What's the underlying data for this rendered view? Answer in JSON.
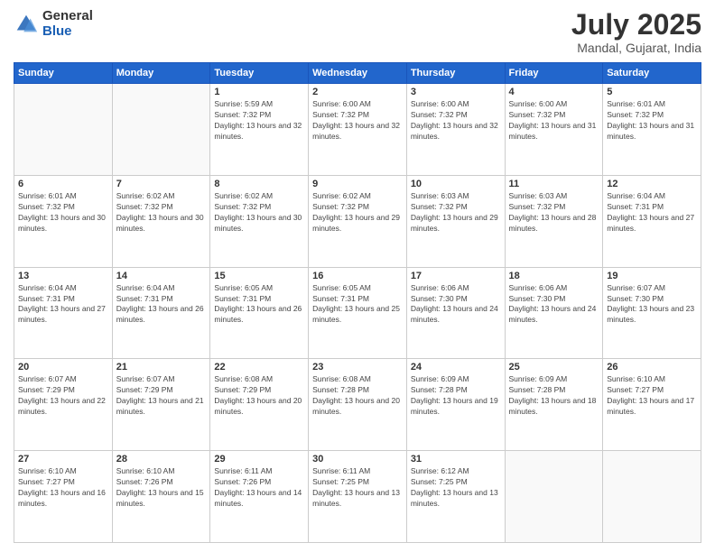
{
  "logo": {
    "general": "General",
    "blue": "Blue"
  },
  "header": {
    "month_year": "July 2025",
    "location": "Mandal, Gujarat, India"
  },
  "weekdays": [
    "Sunday",
    "Monday",
    "Tuesday",
    "Wednesday",
    "Thursday",
    "Friday",
    "Saturday"
  ],
  "weeks": [
    [
      {
        "day": "",
        "info": ""
      },
      {
        "day": "",
        "info": ""
      },
      {
        "day": "1",
        "info": "Sunrise: 5:59 AM\nSunset: 7:32 PM\nDaylight: 13 hours and 32 minutes."
      },
      {
        "day": "2",
        "info": "Sunrise: 6:00 AM\nSunset: 7:32 PM\nDaylight: 13 hours and 32 minutes."
      },
      {
        "day": "3",
        "info": "Sunrise: 6:00 AM\nSunset: 7:32 PM\nDaylight: 13 hours and 32 minutes."
      },
      {
        "day": "4",
        "info": "Sunrise: 6:00 AM\nSunset: 7:32 PM\nDaylight: 13 hours and 31 minutes."
      },
      {
        "day": "5",
        "info": "Sunrise: 6:01 AM\nSunset: 7:32 PM\nDaylight: 13 hours and 31 minutes."
      }
    ],
    [
      {
        "day": "6",
        "info": "Sunrise: 6:01 AM\nSunset: 7:32 PM\nDaylight: 13 hours and 30 minutes."
      },
      {
        "day": "7",
        "info": "Sunrise: 6:02 AM\nSunset: 7:32 PM\nDaylight: 13 hours and 30 minutes."
      },
      {
        "day": "8",
        "info": "Sunrise: 6:02 AM\nSunset: 7:32 PM\nDaylight: 13 hours and 30 minutes."
      },
      {
        "day": "9",
        "info": "Sunrise: 6:02 AM\nSunset: 7:32 PM\nDaylight: 13 hours and 29 minutes."
      },
      {
        "day": "10",
        "info": "Sunrise: 6:03 AM\nSunset: 7:32 PM\nDaylight: 13 hours and 29 minutes."
      },
      {
        "day": "11",
        "info": "Sunrise: 6:03 AM\nSunset: 7:32 PM\nDaylight: 13 hours and 28 minutes."
      },
      {
        "day": "12",
        "info": "Sunrise: 6:04 AM\nSunset: 7:31 PM\nDaylight: 13 hours and 27 minutes."
      }
    ],
    [
      {
        "day": "13",
        "info": "Sunrise: 6:04 AM\nSunset: 7:31 PM\nDaylight: 13 hours and 27 minutes."
      },
      {
        "day": "14",
        "info": "Sunrise: 6:04 AM\nSunset: 7:31 PM\nDaylight: 13 hours and 26 minutes."
      },
      {
        "day": "15",
        "info": "Sunrise: 6:05 AM\nSunset: 7:31 PM\nDaylight: 13 hours and 26 minutes."
      },
      {
        "day": "16",
        "info": "Sunrise: 6:05 AM\nSunset: 7:31 PM\nDaylight: 13 hours and 25 minutes."
      },
      {
        "day": "17",
        "info": "Sunrise: 6:06 AM\nSunset: 7:30 PM\nDaylight: 13 hours and 24 minutes."
      },
      {
        "day": "18",
        "info": "Sunrise: 6:06 AM\nSunset: 7:30 PM\nDaylight: 13 hours and 24 minutes."
      },
      {
        "day": "19",
        "info": "Sunrise: 6:07 AM\nSunset: 7:30 PM\nDaylight: 13 hours and 23 minutes."
      }
    ],
    [
      {
        "day": "20",
        "info": "Sunrise: 6:07 AM\nSunset: 7:29 PM\nDaylight: 13 hours and 22 minutes."
      },
      {
        "day": "21",
        "info": "Sunrise: 6:07 AM\nSunset: 7:29 PM\nDaylight: 13 hours and 21 minutes."
      },
      {
        "day": "22",
        "info": "Sunrise: 6:08 AM\nSunset: 7:29 PM\nDaylight: 13 hours and 20 minutes."
      },
      {
        "day": "23",
        "info": "Sunrise: 6:08 AM\nSunset: 7:28 PM\nDaylight: 13 hours and 20 minutes."
      },
      {
        "day": "24",
        "info": "Sunrise: 6:09 AM\nSunset: 7:28 PM\nDaylight: 13 hours and 19 minutes."
      },
      {
        "day": "25",
        "info": "Sunrise: 6:09 AM\nSunset: 7:28 PM\nDaylight: 13 hours and 18 minutes."
      },
      {
        "day": "26",
        "info": "Sunrise: 6:10 AM\nSunset: 7:27 PM\nDaylight: 13 hours and 17 minutes."
      }
    ],
    [
      {
        "day": "27",
        "info": "Sunrise: 6:10 AM\nSunset: 7:27 PM\nDaylight: 13 hours and 16 minutes."
      },
      {
        "day": "28",
        "info": "Sunrise: 6:10 AM\nSunset: 7:26 PM\nDaylight: 13 hours and 15 minutes."
      },
      {
        "day": "29",
        "info": "Sunrise: 6:11 AM\nSunset: 7:26 PM\nDaylight: 13 hours and 14 minutes."
      },
      {
        "day": "30",
        "info": "Sunrise: 6:11 AM\nSunset: 7:25 PM\nDaylight: 13 hours and 13 minutes."
      },
      {
        "day": "31",
        "info": "Sunrise: 6:12 AM\nSunset: 7:25 PM\nDaylight: 13 hours and 13 minutes."
      },
      {
        "day": "",
        "info": ""
      },
      {
        "day": "",
        "info": ""
      }
    ]
  ]
}
